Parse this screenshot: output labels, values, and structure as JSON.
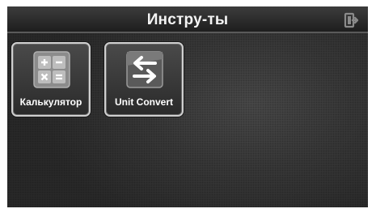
{
  "header": {
    "title": "Инстру-ты",
    "exit_icon": "exit-icon"
  },
  "apps": [
    {
      "label": "Калькулятор",
      "icon": "calculator-icon"
    },
    {
      "label": "Unit Convert",
      "icon": "unit-convert-icon"
    }
  ]
}
